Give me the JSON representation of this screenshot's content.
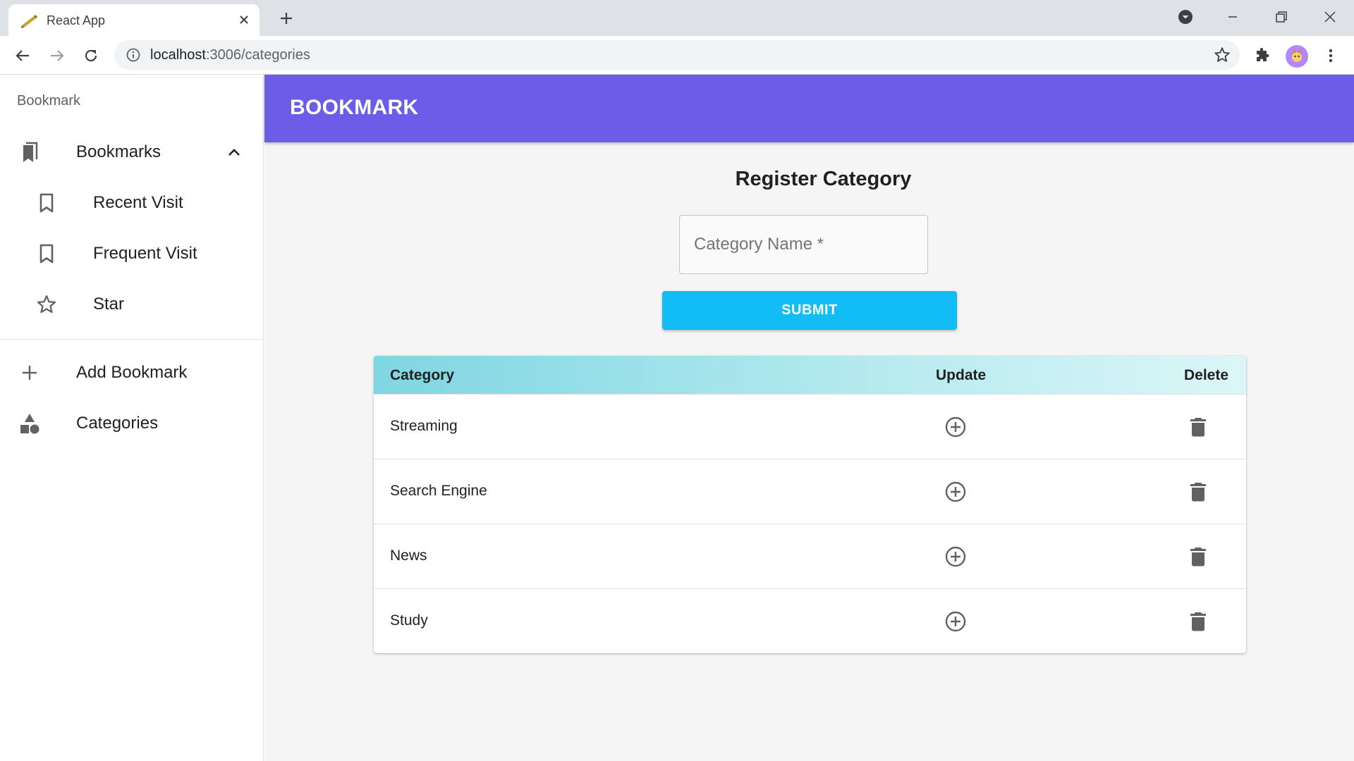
{
  "browser": {
    "tab_title": "React App",
    "url_host": "localhost",
    "url_rest": ":3006/categories"
  },
  "sidebar": {
    "brand": "Bookmark",
    "items": [
      {
        "label": "Bookmarks",
        "icon": "bookmarks-icon"
      },
      {
        "label": "Recent Visit",
        "icon": "bookmark-outline-icon"
      },
      {
        "label": "Frequent Visit",
        "icon": "bookmark-outline-icon"
      },
      {
        "label": "Star",
        "icon": "star-outline-icon"
      },
      {
        "label": "Add Bookmark",
        "icon": "plus-icon"
      },
      {
        "label": "Categories",
        "icon": "category-shapes-icon"
      }
    ]
  },
  "appbar": {
    "title": "BOOKMARK"
  },
  "form": {
    "title": "Register Category",
    "category_placeholder": "Category Name *",
    "submit_label": "SUBMIT"
  },
  "table": {
    "headers": [
      "Category",
      "Update",
      "Delete"
    ],
    "rows": [
      {
        "name": "Streaming"
      },
      {
        "name": "Search Engine"
      },
      {
        "name": "News"
      },
      {
        "name": "Study"
      }
    ]
  },
  "colors": {
    "appbar": "#6c5ce7",
    "submit": "#12bdf5",
    "table_header_start": "#7fd6e2",
    "table_header_end": "#dcf6f8"
  }
}
